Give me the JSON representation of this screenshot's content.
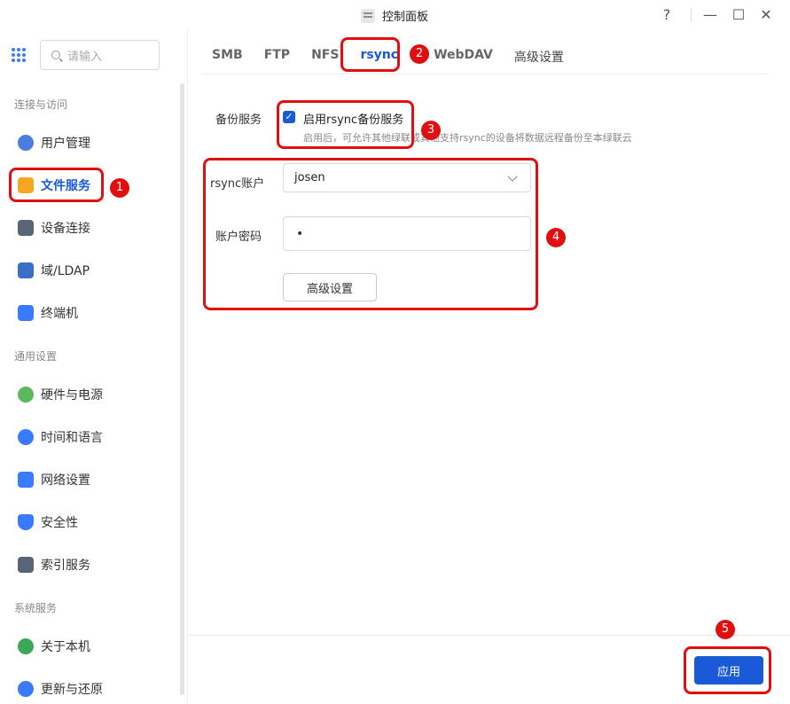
{
  "window": {
    "title": "控制面板",
    "help": "?",
    "minimize": "—",
    "maximize": "☐",
    "close": "✕"
  },
  "search": {
    "placeholder": "请输入"
  },
  "sidebar": {
    "sections": [
      {
        "title": "连接与访问"
      },
      {
        "title": "通用设置"
      },
      {
        "title": "系统服务"
      }
    ],
    "items": [
      {
        "label": "用户管理",
        "icon": "users-icon",
        "color": "#4a7de0"
      },
      {
        "label": "文件服务",
        "icon": "folder-icon",
        "color": "#f5a623"
      },
      {
        "label": "设备连接",
        "icon": "device-icon",
        "color": "#5a6478"
      },
      {
        "label": "域/LDAP",
        "icon": "ldap-icon",
        "color": "#3a6fc8"
      },
      {
        "label": "终端机",
        "icon": "terminal-icon",
        "color": "#3a7afe"
      },
      {
        "label": "硬件与电源",
        "icon": "hardware-icon",
        "color": "#5cb85c"
      },
      {
        "label": "时间和语言",
        "icon": "clock-icon",
        "color": "#3a7afe"
      },
      {
        "label": "网络设置",
        "icon": "network-icon",
        "color": "#3a7afe"
      },
      {
        "label": "安全性",
        "icon": "shield-icon",
        "color": "#3a7afe"
      },
      {
        "label": "索引服务",
        "icon": "index-icon",
        "color": "#5a6478"
      },
      {
        "label": "关于本机",
        "icon": "info-icon",
        "color": "#3aa856"
      },
      {
        "label": "更新与还原",
        "icon": "update-icon",
        "color": "#3a7afe"
      }
    ]
  },
  "tabs": [
    "SMB",
    "FTP",
    "NFS",
    "rsync",
    "WebDAV",
    "高级设置"
  ],
  "form": {
    "backup_label": "备份服务",
    "enable_label": "启用rsync备份服务",
    "hint": "启用后，可允许其他绿联或其他支持rsync的设备将数据远程备份至本绿联云",
    "account_label": "rsync账户",
    "account_value": "josen",
    "password_label": "账户密码",
    "password_value": "•",
    "advanced_button": "高级设置"
  },
  "footer": {
    "apply": "应用"
  },
  "annotations": [
    "1",
    "2",
    "3",
    "4",
    "5"
  ],
  "colors": {
    "accent": "#1a5ad8",
    "annotation": "#e01010"
  }
}
